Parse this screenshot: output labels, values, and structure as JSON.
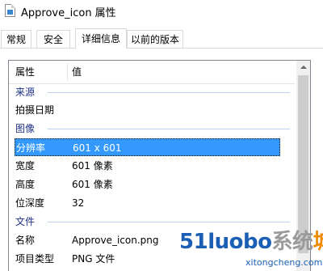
{
  "window": {
    "title": "Approve_icon 属性",
    "icon": "image-file-icon"
  },
  "tabs": [
    {
      "label": "常规",
      "active": false
    },
    {
      "label": "安全",
      "active": false
    },
    {
      "label": "详细信息",
      "active": true
    },
    {
      "label": "以前的版本",
      "active": false
    }
  ],
  "table": {
    "header": {
      "col_property": "属性",
      "col_value": "值"
    },
    "rows": [
      {
        "type": "group",
        "key": "来源",
        "value": ""
      },
      {
        "type": "item",
        "key": "拍摄日期",
        "value": ""
      },
      {
        "type": "group",
        "key": "图像",
        "value": ""
      },
      {
        "type": "item",
        "key": "分辨率",
        "value": "601 x 601",
        "selected": true
      },
      {
        "type": "item",
        "key": "宽度",
        "value": "601 像素"
      },
      {
        "type": "item",
        "key": "高度",
        "value": "601 像素"
      },
      {
        "type": "item",
        "key": "位深度",
        "value": "32"
      },
      {
        "type": "group",
        "key": "文件",
        "value": ""
      },
      {
        "type": "item",
        "key": "名称",
        "value": "Approve_icon.png"
      },
      {
        "type": "item",
        "key": "项目类型",
        "value": "PNG 文件"
      }
    ]
  },
  "watermark": {
    "part1": "51",
    "part2": "luobo",
    "part3": "系统",
    "part4": "城",
    "sub": "xitongcheng.com"
  },
  "colors": {
    "selection": "#3399ff",
    "group_text": "#1e3287",
    "accent": "#1a5fb4"
  }
}
